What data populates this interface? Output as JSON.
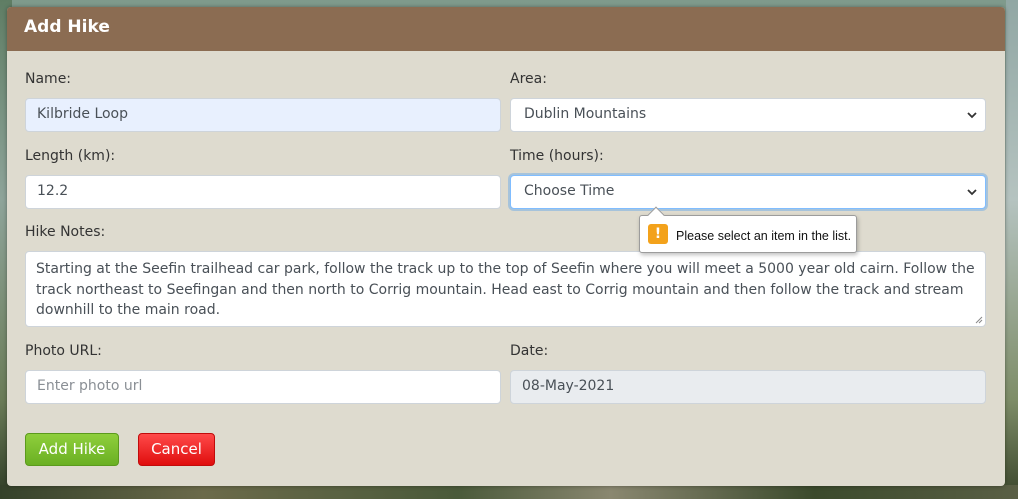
{
  "modal": {
    "title": "Add Hike"
  },
  "form": {
    "name": {
      "label": "Name:",
      "value": "Kilbride Loop"
    },
    "area": {
      "label": "Area:",
      "value": "Dublin Mountains"
    },
    "length": {
      "label": "Length (km):",
      "value": "12.2"
    },
    "time": {
      "label": "Time (hours):",
      "value": "Choose Time"
    },
    "notes": {
      "label": "Hike Notes:",
      "value": "Starting at the Seefin trailhead car park, follow the track up to the top of Seefin where you will meet a 5000 year old cairn. Follow the track northeast to Seefingan and then north to Corrig mountain. Head east to Corrig mountain and then follow the track and stream downhill to the main road."
    },
    "photo": {
      "label": "Photo URL:",
      "placeholder": "Enter photo url"
    },
    "date": {
      "label": "Date:",
      "value": "08-May-2021"
    }
  },
  "buttons": {
    "add": "Add Hike",
    "cancel": "Cancel"
  },
  "validation": {
    "message": "Please select an item in the list.",
    "icon": "!"
  },
  "colors": {
    "header": "#8b6c52",
    "modal_bg": "#dedbcf",
    "add_button": "#7cc02f",
    "cancel_button": "#f21c1c",
    "warning_icon": "#f3a21b"
  },
  "icons": {
    "select_chevron": "chevron-down-icon",
    "warning": "warning-icon",
    "resize": "resize-grip-icon"
  }
}
